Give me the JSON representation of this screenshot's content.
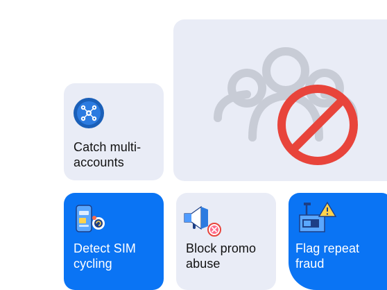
{
  "colors": {
    "light_card": "#e9ecf6",
    "blue_card": "#0a74f4",
    "ban_red": "#e8443b",
    "people_gray": "#c8ccd6"
  },
  "cards": {
    "multi_accounts": {
      "label": "Catch multi-\naccounts",
      "icon": "network-nodes-icon"
    },
    "hero": {
      "icon": "people-banned-icon"
    },
    "sim_cycling": {
      "label": "Detect SIM\ncycling",
      "icon": "phone-sim-icon"
    },
    "promo_abuse": {
      "label": "Block promo\nabuse",
      "icon": "megaphone-blocked-icon"
    },
    "repeat_fraud": {
      "label": "Flag repeat\nfraud",
      "icon": "warning-device-icon"
    }
  }
}
